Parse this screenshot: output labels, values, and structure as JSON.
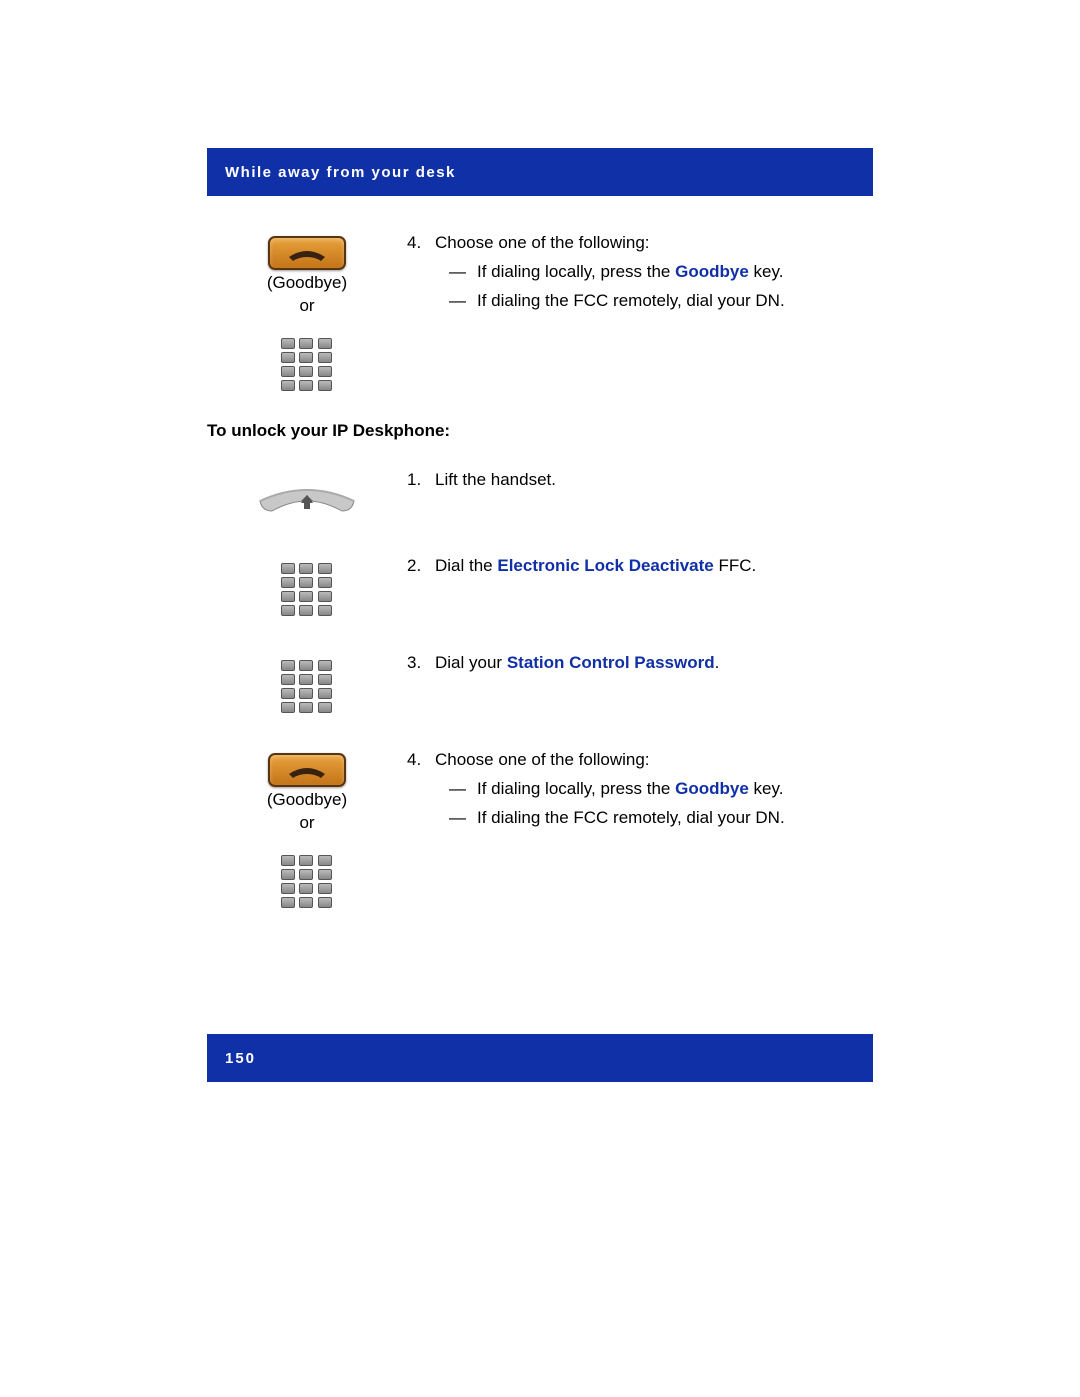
{
  "header": {
    "title": "While away from your desk"
  },
  "section1": {
    "goodbye_caption": "(Goodbye)",
    "or_label": "or",
    "step4": {
      "num": "4.",
      "intro": "Choose one of the following:",
      "sub1_pre": "If dialing locally, press the ",
      "sub1_bold": "Goodbye",
      "sub1_post": " key.",
      "sub2": "If dialing the FCC remotely, dial your DN."
    }
  },
  "unlock_title": "To unlock your IP Deskphone:",
  "section2": {
    "step1": {
      "num": "1.",
      "text": "Lift the handset."
    },
    "step2": {
      "num": "2.",
      "pre": "Dial the ",
      "bold": "Electronic Lock Deactivate",
      "post": " FFC."
    },
    "step3": {
      "num": "3.",
      "pre": "Dial your ",
      "bold": "Station Control Password",
      "post": "."
    },
    "goodbye_caption": "(Goodbye)",
    "or_label": "or",
    "step4": {
      "num": "4.",
      "intro": "Choose one of the following:",
      "sub1_pre": "If dialing locally, press the ",
      "sub1_bold": "Goodbye",
      "sub1_post": " key.",
      "sub2": "If dialing the FCC remotely, dial your DN."
    }
  },
  "footer": {
    "page_number": "150"
  },
  "dash": "—"
}
